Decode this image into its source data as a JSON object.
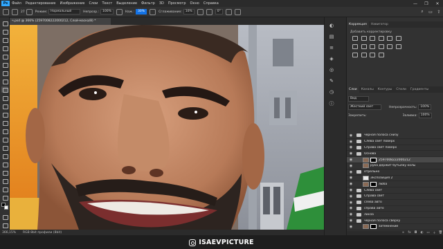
{
  "app": {
    "logo": "Ps"
  },
  "menu": [
    "Файл",
    "Редактирование",
    "Изображение",
    "Слои",
    "Текст",
    "Выделение",
    "Фильтр",
    "3D",
    "Просмотр",
    "Окно",
    "Справка"
  ],
  "window_controls": [
    "—",
    "❐",
    "✕"
  ],
  "options_bar": {
    "brush_size": "27",
    "mode_label": "Режим:",
    "mode_value": "Нормальный",
    "opacity_label": "Непрозр.:",
    "opacity_value": "100%",
    "flow_label": "Наж.:",
    "flow_value": "30%",
    "smoothing_label": "Сглаживание:",
    "smoothing_value": "10%",
    "angle_value": "0°"
  },
  "document": {
    "tab_title": "ч.psd @ 366% (2597008222000212, Слой-маска/8) *"
  },
  "status": {
    "zoom": "366,15%",
    "info": "RGB 8bit профили (8bit)"
  },
  "icon_strip": [
    "adjustments-icon",
    "libraries-icon",
    "properties-icon",
    "layers-icon",
    "channels-icon",
    "paths-icon",
    "history-icon",
    "info-icon"
  ],
  "adjustments_panel": {
    "tabs": [
      "Коррекция",
      "Навигатор"
    ],
    "title": "Добавить корректировку",
    "icons": [
      "brightness-icon",
      "levels-icon",
      "curves-icon",
      "exposure-icon",
      "vibrance-icon",
      "hue-sat-icon",
      "color-balance-icon",
      "bw-icon",
      "photo-filter-icon",
      "channel-mixer-icon",
      "color-lookup-icon",
      "invert-icon",
      "posterize-icon",
      "threshold-icon",
      "gradient-map-icon",
      "selective-color-icon"
    ]
  },
  "layers_panel": {
    "tabs": [
      "Слои",
      "Каналы",
      "Контуры",
      "Стили",
      "Градиенты"
    ],
    "filter_label": "Вид",
    "blend_mode": "Жесткий свет",
    "opacity_label": "Непрозрачность:",
    "opacity_value": "100%",
    "lock_label": "Закрепить:",
    "fill_label": "Заливка:",
    "fill_value": "100%",
    "layers": [
      {
        "name": "черная полоса снизу",
        "kind": "folder",
        "selected": false
      },
      {
        "name": "Слева свет поверх",
        "kind": "folder",
        "selected": false
      },
      {
        "name": "Справа свет поверх",
        "kind": "folder",
        "selected": false
      },
      {
        "name": "Основа",
        "kind": "folder",
        "selected": false
      },
      {
        "name": "2597008222000212",
        "kind": "masked",
        "selected": true
      },
      {
        "name": "рука держит бутылку колы",
        "kind": "layer",
        "selected": false
      },
      {
        "name": "отрельно",
        "kind": "folder",
        "selected": false
      },
      {
        "name": "Экспозиция 2",
        "kind": "adjust",
        "selected": false
      },
      {
        "name": "люба",
        "kind": "masked",
        "selected": false
      },
      {
        "name": "Слева свет",
        "kind": "folder",
        "selected": false
      },
      {
        "name": "Справа свет",
        "kind": "folder",
        "selected": false
      },
      {
        "name": "слева авто",
        "kind": "folder",
        "selected": false
      },
      {
        "name": "справа авто",
        "kind": "folder",
        "selected": false
      },
      {
        "name": "линза",
        "kind": "folder",
        "selected": false
      },
      {
        "name": "черная полоса сверху",
        "kind": "folder",
        "selected": false
      },
      {
        "name": "затемнение",
        "kind": "masked",
        "selected": false
      }
    ]
  },
  "overlay": {
    "handle": "ISAEVPICTURE"
  }
}
